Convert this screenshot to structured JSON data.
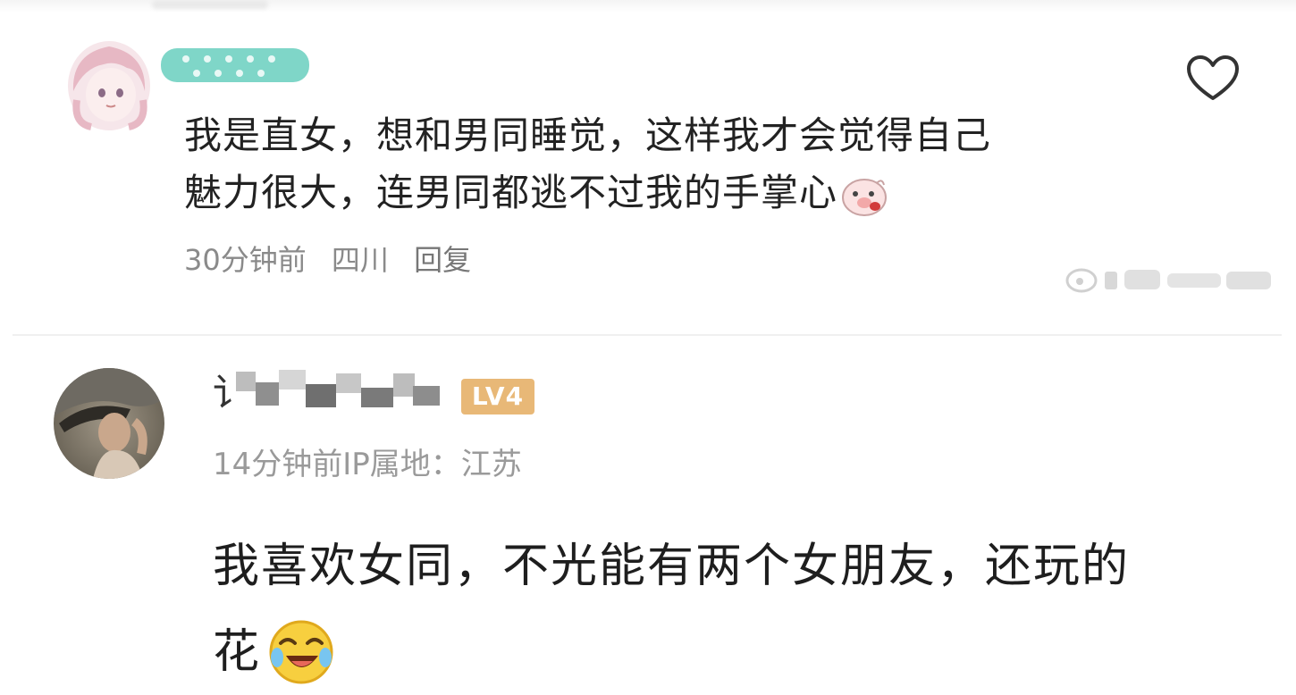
{
  "comments": [
    {
      "text_lines": [
        "我是直女，想和男同睡觉，这样我才会觉得自己",
        "魅力很大，连男同都逃不过我的手掌心"
      ],
      "emoji_icon": "pig-face-emoji",
      "time": "30分钟前",
      "location": "四川",
      "reply_label": "回复",
      "like_icon": "heart-outline-icon"
    },
    {
      "level_badge": "LV4",
      "meta": "14分钟前IP属地：江苏",
      "text_lines": [
        "我喜欢女同，不光能有两个女朋友，还玩的",
        "花"
      ],
      "emoji_icon": "laughing-crying-emoji"
    }
  ],
  "colors": {
    "badge": "#e8b877",
    "name_blur": "#7fd6c8",
    "meta_text": "#8a8a8a"
  }
}
